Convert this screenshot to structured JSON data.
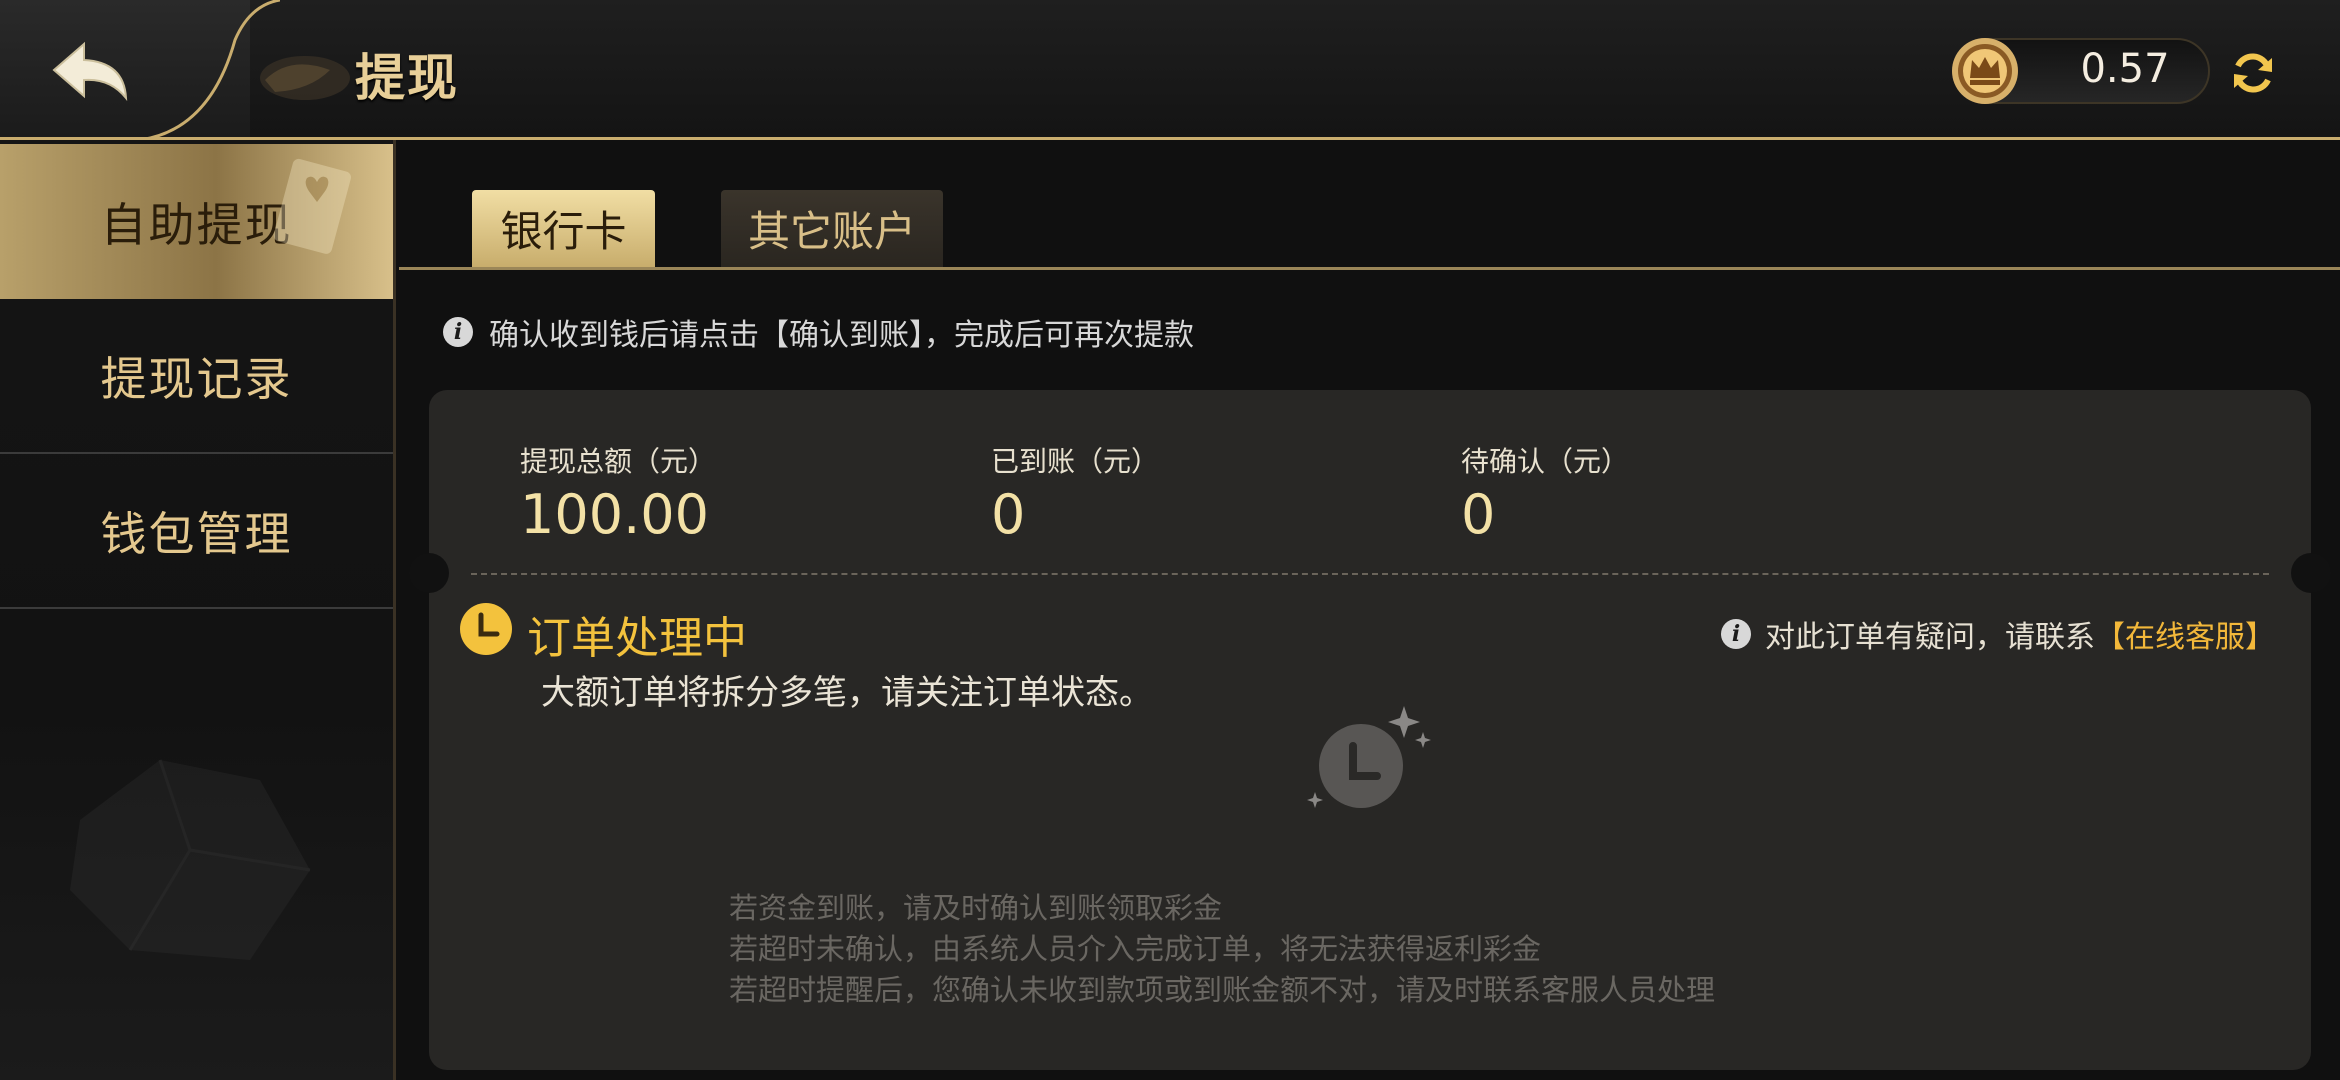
{
  "header": {
    "title": "提现",
    "balance": "0.57",
    "back_icon": "back-arrow-icon",
    "coin_icon": "crown-coin-icon",
    "refresh_icon": "refresh-icon"
  },
  "sidebar": {
    "items": [
      {
        "label": "自助提现",
        "active": true
      },
      {
        "label": "提现记录",
        "active": false
      },
      {
        "label": "钱包管理",
        "active": false
      }
    ]
  },
  "tabs": [
    {
      "label": "银行卡",
      "active": true
    },
    {
      "label": "其它账户",
      "active": false
    }
  ],
  "info_text": "确认收到钱后请点击【确认到账】，完成后可再次提款",
  "stats": [
    {
      "label": "提现总额（元）",
      "value": "100.00"
    },
    {
      "label": "已到账（元）",
      "value": "0"
    },
    {
      "label": "待确认（元）",
      "value": "0"
    }
  ],
  "order": {
    "status": "订单处理中",
    "subtitle": "大额订单将拆分多笔，请关注订单状态。",
    "help_prefix": "对此订单有疑问，请联系",
    "help_link": "【在线客服】"
  },
  "notes": [
    "若资金到账，请及时确认到账领取彩金",
    "若超时未确认，由系统人员介入完成订单，将无法获得返利彩金",
    "若超时提醒后，您确认未收到款项或到账金额不对，请及时联系客服人员处理"
  ],
  "colors": {
    "accent_gold": "#e8cf98",
    "status_yellow": "#f3c23d",
    "link_orange": "#f3b83a"
  }
}
